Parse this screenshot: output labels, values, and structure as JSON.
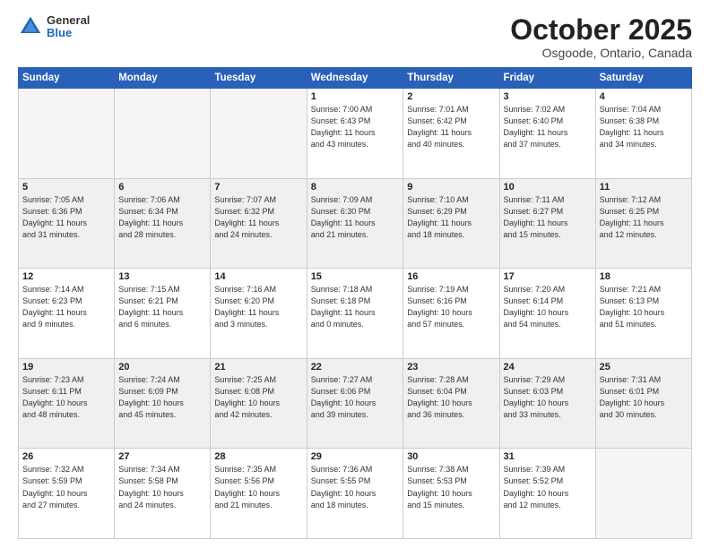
{
  "header": {
    "logo_general": "General",
    "logo_blue": "Blue",
    "month": "October 2025",
    "location": "Osgoode, Ontario, Canada"
  },
  "weekdays": [
    "Sunday",
    "Monday",
    "Tuesday",
    "Wednesday",
    "Thursday",
    "Friday",
    "Saturday"
  ],
  "weeks": [
    [
      {
        "day": "",
        "info": ""
      },
      {
        "day": "",
        "info": ""
      },
      {
        "day": "",
        "info": ""
      },
      {
        "day": "1",
        "info": "Sunrise: 7:00 AM\nSunset: 6:43 PM\nDaylight: 11 hours\nand 43 minutes."
      },
      {
        "day": "2",
        "info": "Sunrise: 7:01 AM\nSunset: 6:42 PM\nDaylight: 11 hours\nand 40 minutes."
      },
      {
        "day": "3",
        "info": "Sunrise: 7:02 AM\nSunset: 6:40 PM\nDaylight: 11 hours\nand 37 minutes."
      },
      {
        "day": "4",
        "info": "Sunrise: 7:04 AM\nSunset: 6:38 PM\nDaylight: 11 hours\nand 34 minutes."
      }
    ],
    [
      {
        "day": "5",
        "info": "Sunrise: 7:05 AM\nSunset: 6:36 PM\nDaylight: 11 hours\nand 31 minutes."
      },
      {
        "day": "6",
        "info": "Sunrise: 7:06 AM\nSunset: 6:34 PM\nDaylight: 11 hours\nand 28 minutes."
      },
      {
        "day": "7",
        "info": "Sunrise: 7:07 AM\nSunset: 6:32 PM\nDaylight: 11 hours\nand 24 minutes."
      },
      {
        "day": "8",
        "info": "Sunrise: 7:09 AM\nSunset: 6:30 PM\nDaylight: 11 hours\nand 21 minutes."
      },
      {
        "day": "9",
        "info": "Sunrise: 7:10 AM\nSunset: 6:29 PM\nDaylight: 11 hours\nand 18 minutes."
      },
      {
        "day": "10",
        "info": "Sunrise: 7:11 AM\nSunset: 6:27 PM\nDaylight: 11 hours\nand 15 minutes."
      },
      {
        "day": "11",
        "info": "Sunrise: 7:12 AM\nSunset: 6:25 PM\nDaylight: 11 hours\nand 12 minutes."
      }
    ],
    [
      {
        "day": "12",
        "info": "Sunrise: 7:14 AM\nSunset: 6:23 PM\nDaylight: 11 hours\nand 9 minutes."
      },
      {
        "day": "13",
        "info": "Sunrise: 7:15 AM\nSunset: 6:21 PM\nDaylight: 11 hours\nand 6 minutes."
      },
      {
        "day": "14",
        "info": "Sunrise: 7:16 AM\nSunset: 6:20 PM\nDaylight: 11 hours\nand 3 minutes."
      },
      {
        "day": "15",
        "info": "Sunrise: 7:18 AM\nSunset: 6:18 PM\nDaylight: 11 hours\nand 0 minutes."
      },
      {
        "day": "16",
        "info": "Sunrise: 7:19 AM\nSunset: 6:16 PM\nDaylight: 10 hours\nand 57 minutes."
      },
      {
        "day": "17",
        "info": "Sunrise: 7:20 AM\nSunset: 6:14 PM\nDaylight: 10 hours\nand 54 minutes."
      },
      {
        "day": "18",
        "info": "Sunrise: 7:21 AM\nSunset: 6:13 PM\nDaylight: 10 hours\nand 51 minutes."
      }
    ],
    [
      {
        "day": "19",
        "info": "Sunrise: 7:23 AM\nSunset: 6:11 PM\nDaylight: 10 hours\nand 48 minutes."
      },
      {
        "day": "20",
        "info": "Sunrise: 7:24 AM\nSunset: 6:09 PM\nDaylight: 10 hours\nand 45 minutes."
      },
      {
        "day": "21",
        "info": "Sunrise: 7:25 AM\nSunset: 6:08 PM\nDaylight: 10 hours\nand 42 minutes."
      },
      {
        "day": "22",
        "info": "Sunrise: 7:27 AM\nSunset: 6:06 PM\nDaylight: 10 hours\nand 39 minutes."
      },
      {
        "day": "23",
        "info": "Sunrise: 7:28 AM\nSunset: 6:04 PM\nDaylight: 10 hours\nand 36 minutes."
      },
      {
        "day": "24",
        "info": "Sunrise: 7:29 AM\nSunset: 6:03 PM\nDaylight: 10 hours\nand 33 minutes."
      },
      {
        "day": "25",
        "info": "Sunrise: 7:31 AM\nSunset: 6:01 PM\nDaylight: 10 hours\nand 30 minutes."
      }
    ],
    [
      {
        "day": "26",
        "info": "Sunrise: 7:32 AM\nSunset: 5:59 PM\nDaylight: 10 hours\nand 27 minutes."
      },
      {
        "day": "27",
        "info": "Sunrise: 7:34 AM\nSunset: 5:58 PM\nDaylight: 10 hours\nand 24 minutes."
      },
      {
        "day": "28",
        "info": "Sunrise: 7:35 AM\nSunset: 5:56 PM\nDaylight: 10 hours\nand 21 minutes."
      },
      {
        "day": "29",
        "info": "Sunrise: 7:36 AM\nSunset: 5:55 PM\nDaylight: 10 hours\nand 18 minutes."
      },
      {
        "day": "30",
        "info": "Sunrise: 7:38 AM\nSunset: 5:53 PM\nDaylight: 10 hours\nand 15 minutes."
      },
      {
        "day": "31",
        "info": "Sunrise: 7:39 AM\nSunset: 5:52 PM\nDaylight: 10 hours\nand 12 minutes."
      },
      {
        "day": "",
        "info": ""
      }
    ]
  ]
}
